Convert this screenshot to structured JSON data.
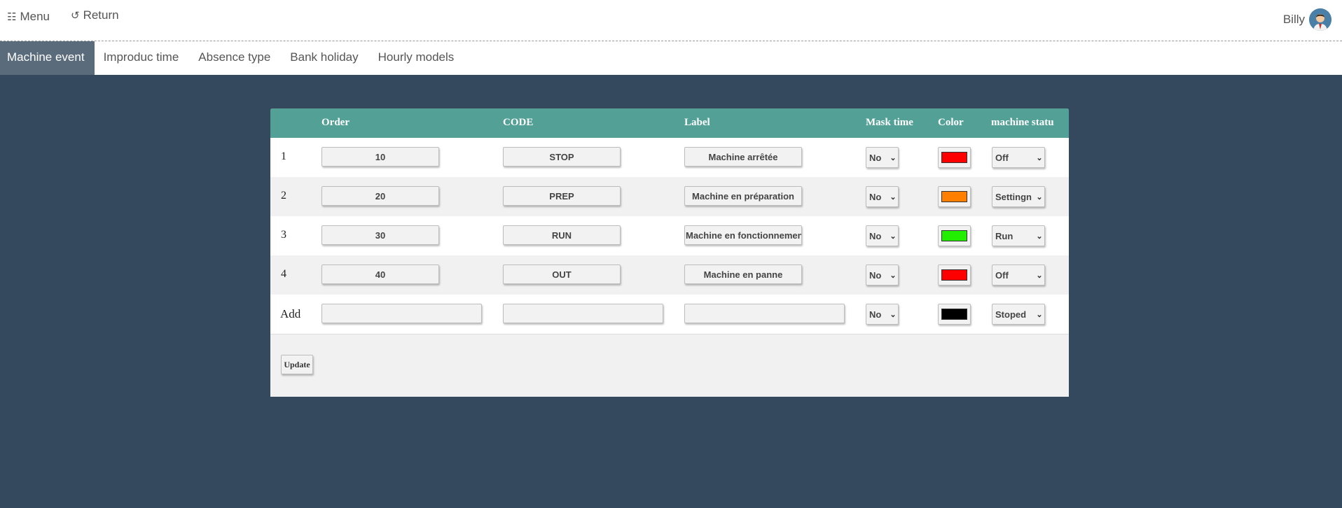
{
  "topbar": {
    "menu_icon": "grid-list-icon",
    "menu_label": "Menu",
    "return_icon": "refresh-arrow-icon",
    "return_label": "Return",
    "user_name": "Billy"
  },
  "tabs": [
    {
      "label": "Machine event",
      "active": true
    },
    {
      "label": "Improduc time"
    },
    {
      "label": "Absence type"
    },
    {
      "label": "Bank holiday"
    },
    {
      "label": "Hourly models"
    }
  ],
  "table": {
    "headers": {
      "order": "Order",
      "code": "CODE",
      "label": "Label",
      "mask_time": "Mask time",
      "color": "Color",
      "machine_status": "machine statu"
    },
    "rows": [
      {
        "num": "1",
        "order": "10",
        "code": "STOP",
        "label": "Machine arrêtée",
        "mask": "No",
        "color": "#ff0000",
        "status": "Off"
      },
      {
        "num": "2",
        "order": "20",
        "code": "PREP",
        "label": "Machine en préparation",
        "mask": "No",
        "color": "#ff7f00",
        "status": "Settingn"
      },
      {
        "num": "3",
        "order": "30",
        "code": "RUN",
        "label": "Machine en fonctionnemen",
        "mask": "No",
        "color": "#22ee00",
        "status": "Run"
      },
      {
        "num": "4",
        "order": "40",
        "code": "OUT",
        "label": "Machine en panne",
        "mask": "No",
        "color": "#ff0000",
        "status": "Off"
      }
    ],
    "add_row": {
      "num": "Add",
      "mask": "No",
      "color": "#000000",
      "status": "Stoped"
    }
  },
  "update_label": "Update",
  "colors": {
    "background": "#34495e",
    "header": "#52a096",
    "active_tab": "#5a6b7b"
  }
}
